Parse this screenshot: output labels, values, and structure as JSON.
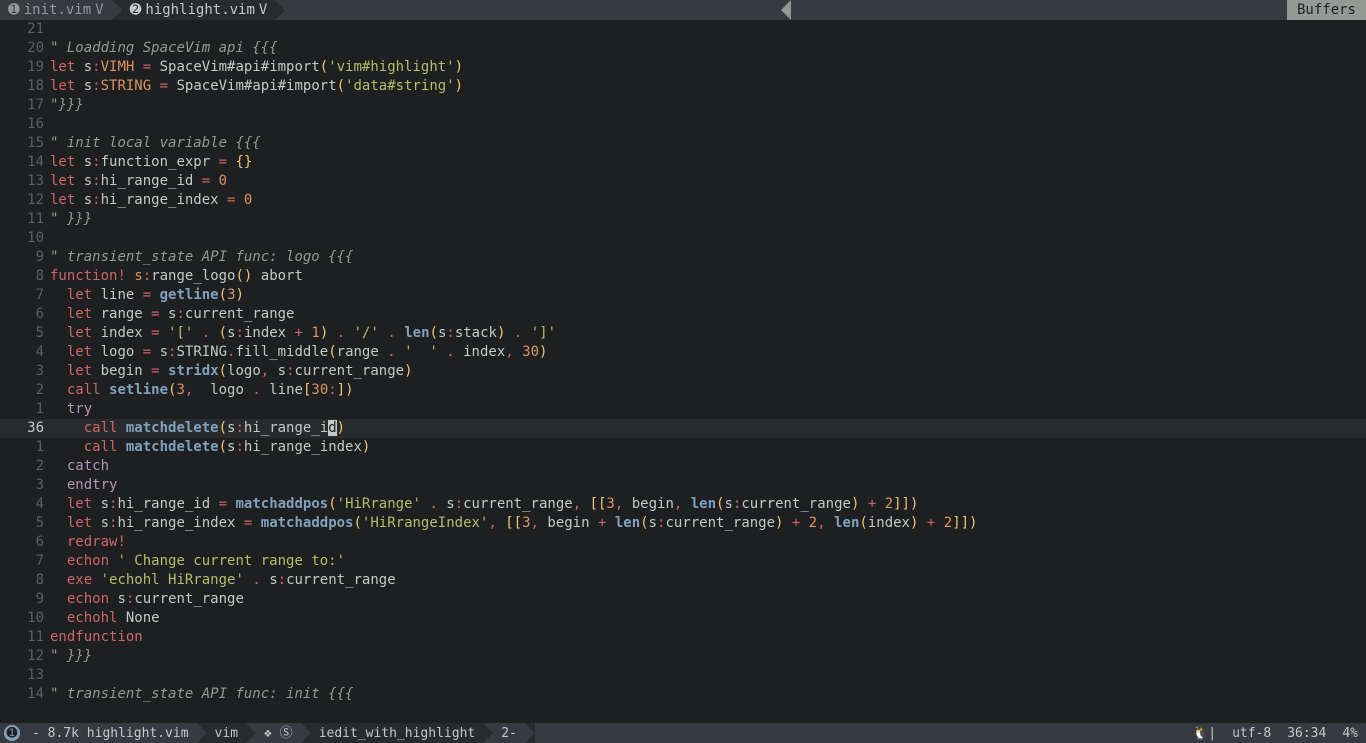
{
  "tabline": {
    "tabs": [
      {
        "num": "➊",
        "name": "init.vim",
        "active": false
      },
      {
        "num": "➋",
        "name": "highlight.vim",
        "active": true
      }
    ],
    "buffers_label": "Buffers"
  },
  "statusline": {
    "window_num": "➊",
    "file_info": "- 8.7k highlight.vim",
    "filetype": "vim",
    "spell": "❖ Ⓢ",
    "branch": "  iedit_with_highlight",
    "iedit": "2-",
    "os_icon": "🐧",
    "encoding": "utf-8",
    "position": "36:34",
    "percent": "4%"
  },
  "cursor_line_abs": 36,
  "lines": [
    {
      "rel": "21",
      "code": []
    },
    {
      "rel": "20",
      "code": [
        [
          "comment",
          "\""
        ],
        [
          "comment",
          " Loadding SpaceVim api {{{"
        ]
      ]
    },
    {
      "rel": "19",
      "code": [
        [
          "kw",
          "let"
        ],
        [
          "ident",
          " s"
        ],
        [
          "sp",
          ":"
        ],
        [
          "scope",
          "VIMH"
        ],
        [
          "ident",
          " "
        ],
        [
          "sp",
          "="
        ],
        [
          "ident",
          " SpaceVim#api#import"
        ],
        [
          "paren",
          "("
        ],
        [
          "str",
          "'vim#highlight'"
        ],
        [
          "paren",
          ")"
        ]
      ]
    },
    {
      "rel": "18",
      "code": [
        [
          "kw",
          "let"
        ],
        [
          "ident",
          " s"
        ],
        [
          "sp",
          ":"
        ],
        [
          "scope",
          "STRING"
        ],
        [
          "ident",
          " "
        ],
        [
          "sp",
          "="
        ],
        [
          "ident",
          " SpaceVim#api#import"
        ],
        [
          "paren",
          "("
        ],
        [
          "str",
          "'data#string'"
        ],
        [
          "paren",
          ")"
        ]
      ]
    },
    {
      "rel": "17",
      "code": [
        [
          "comment",
          "\""
        ],
        [
          "comment",
          "}}}"
        ]
      ]
    },
    {
      "rel": "16",
      "code": []
    },
    {
      "rel": "15",
      "code": [
        [
          "comment",
          "\""
        ],
        [
          "comment",
          " init local variable {{{"
        ]
      ]
    },
    {
      "rel": "14",
      "code": [
        [
          "kw",
          "let"
        ],
        [
          "ident",
          " s"
        ],
        [
          "sp",
          ":"
        ],
        [
          "ident",
          "function_expr "
        ],
        [
          "sp",
          "="
        ],
        [
          "ident",
          " "
        ],
        [
          "paren",
          "{}"
        ]
      ]
    },
    {
      "rel": "13",
      "code": [
        [
          "kw",
          "let"
        ],
        [
          "ident",
          " s"
        ],
        [
          "sp",
          ":"
        ],
        [
          "ident",
          "hi_range_id "
        ],
        [
          "sp",
          "="
        ],
        [
          "ident",
          " "
        ],
        [
          "num",
          "0"
        ]
      ]
    },
    {
      "rel": "12",
      "code": [
        [
          "kw",
          "let"
        ],
        [
          "ident",
          " s"
        ],
        [
          "sp",
          ":"
        ],
        [
          "ident",
          "hi_range_index "
        ],
        [
          "sp",
          "="
        ],
        [
          "ident",
          " "
        ],
        [
          "num",
          "0"
        ]
      ]
    },
    {
      "rel": "11",
      "code": [
        [
          "comment",
          "\""
        ],
        [
          "comment",
          " }}}"
        ]
      ]
    },
    {
      "rel": "10",
      "code": []
    },
    {
      "rel": "9",
      "code": [
        [
          "comment",
          "\""
        ],
        [
          "comment",
          " transient_state API func: logo {{{"
        ]
      ]
    },
    {
      "rel": "8",
      "code": [
        [
          "kw",
          "function"
        ],
        [
          "sp",
          "!"
        ],
        [
          "ident",
          " "
        ],
        [
          "scope",
          "s"
        ],
        [
          "sp",
          ":"
        ],
        [
          "ident",
          "range_logo"
        ],
        [
          "paren",
          "()"
        ],
        [
          "ident",
          " abort"
        ]
      ]
    },
    {
      "rel": "7",
      "code": [
        [
          "ident",
          "  "
        ],
        [
          "kw",
          "let"
        ],
        [
          "ident",
          " line "
        ],
        [
          "sp",
          "="
        ],
        [
          "ident",
          " "
        ],
        [
          "func",
          "getline"
        ],
        [
          "paren",
          "("
        ],
        [
          "num",
          "3"
        ],
        [
          "paren",
          ")"
        ]
      ]
    },
    {
      "rel": "6",
      "code": [
        [
          "ident",
          "  "
        ],
        [
          "kw",
          "let"
        ],
        [
          "ident",
          " range "
        ],
        [
          "sp",
          "="
        ],
        [
          "ident",
          " s"
        ],
        [
          "sp",
          ":"
        ],
        [
          "ident",
          "current_range"
        ]
      ]
    },
    {
      "rel": "5",
      "code": [
        [
          "ident",
          "  "
        ],
        [
          "kw",
          "let"
        ],
        [
          "ident",
          " index "
        ],
        [
          "sp",
          "="
        ],
        [
          "ident",
          " "
        ],
        [
          "str",
          "'['"
        ],
        [
          "ident",
          " "
        ],
        [
          "sp",
          "."
        ],
        [
          "ident",
          " "
        ],
        [
          "paren",
          "("
        ],
        [
          "ident",
          "s"
        ],
        [
          "sp",
          ":"
        ],
        [
          "ident",
          "index "
        ],
        [
          "sp",
          "+"
        ],
        [
          "ident",
          " "
        ],
        [
          "num",
          "1"
        ],
        [
          "paren",
          ")"
        ],
        [
          "ident",
          " "
        ],
        [
          "sp",
          "."
        ],
        [
          "ident",
          " "
        ],
        [
          "str",
          "'/'"
        ],
        [
          "ident",
          " "
        ],
        [
          "sp",
          "."
        ],
        [
          "ident",
          " "
        ],
        [
          "func",
          "len"
        ],
        [
          "paren",
          "("
        ],
        [
          "ident",
          "s"
        ],
        [
          "sp",
          ":"
        ],
        [
          "ident",
          "stack"
        ],
        [
          "paren",
          ")"
        ],
        [
          "ident",
          " "
        ],
        [
          "sp",
          "."
        ],
        [
          "ident",
          " "
        ],
        [
          "str",
          "']'"
        ]
      ]
    },
    {
      "rel": "4",
      "code": [
        [
          "ident",
          "  "
        ],
        [
          "kw",
          "let"
        ],
        [
          "ident",
          " logo "
        ],
        [
          "sp",
          "="
        ],
        [
          "ident",
          " s"
        ],
        [
          "sp",
          ":"
        ],
        [
          "ident",
          "STRING"
        ],
        [
          "sp",
          "."
        ],
        [
          "ident",
          "fill_middle"
        ],
        [
          "paren",
          "("
        ],
        [
          "ident",
          "range "
        ],
        [
          "sp",
          "."
        ],
        [
          "ident",
          " "
        ],
        [
          "str",
          "'  '"
        ],
        [
          "ident",
          " "
        ],
        [
          "sp",
          "."
        ],
        [
          "ident",
          " index"
        ],
        [
          "sp",
          ","
        ],
        [
          "ident",
          " "
        ],
        [
          "num",
          "30"
        ],
        [
          "paren",
          ")"
        ]
      ]
    },
    {
      "rel": "3",
      "code": [
        [
          "ident",
          "  "
        ],
        [
          "kw",
          "let"
        ],
        [
          "ident",
          " begin "
        ],
        [
          "sp",
          "="
        ],
        [
          "ident",
          " "
        ],
        [
          "func",
          "stridx"
        ],
        [
          "paren",
          "("
        ],
        [
          "ident",
          "logo"
        ],
        [
          "sp",
          ","
        ],
        [
          "ident",
          " s"
        ],
        [
          "sp",
          ":"
        ],
        [
          "ident",
          "current_range"
        ],
        [
          "paren",
          ")"
        ]
      ]
    },
    {
      "rel": "2",
      "code": [
        [
          "ident",
          "  "
        ],
        [
          "kw",
          "call"
        ],
        [
          "ident",
          " "
        ],
        [
          "func",
          "setline"
        ],
        [
          "paren",
          "("
        ],
        [
          "num",
          "3"
        ],
        [
          "sp",
          ","
        ],
        [
          "ident",
          "  logo "
        ],
        [
          "sp",
          "."
        ],
        [
          "ident",
          " line"
        ],
        [
          "paren",
          "["
        ],
        [
          "num",
          "30"
        ],
        [
          "sp",
          ":"
        ],
        [
          "paren",
          "]"
        ],
        [
          "paren",
          ")"
        ]
      ]
    },
    {
      "rel": "1",
      "code": [
        [
          "ident",
          "  "
        ],
        [
          "kw2",
          "try"
        ]
      ]
    },
    {
      "rel": "36",
      "current": true,
      "code": [
        [
          "ident",
          "    "
        ],
        [
          "kw",
          "call"
        ],
        [
          "ident",
          " "
        ],
        [
          "func",
          "matchdelete"
        ],
        [
          "paren",
          "("
        ],
        [
          "ident",
          "s"
        ],
        [
          "sp",
          ":"
        ],
        [
          "ident",
          "hi_range_i"
        ],
        [
          "cursor",
          "d"
        ],
        [
          "paren",
          ")"
        ]
      ]
    },
    {
      "rel": "1",
      "code": [
        [
          "ident",
          "    "
        ],
        [
          "kw",
          "call"
        ],
        [
          "ident",
          " "
        ],
        [
          "func",
          "matchdelete"
        ],
        [
          "paren",
          "("
        ],
        [
          "ident",
          "s"
        ],
        [
          "sp",
          ":"
        ],
        [
          "ident",
          "hi_range_index"
        ],
        [
          "paren",
          ")"
        ]
      ]
    },
    {
      "rel": "2",
      "code": [
        [
          "ident",
          "  "
        ],
        [
          "kw2",
          "catch"
        ]
      ]
    },
    {
      "rel": "3",
      "code": [
        [
          "ident",
          "  "
        ],
        [
          "kw2",
          "endtry"
        ]
      ]
    },
    {
      "rel": "4",
      "code": [
        [
          "ident",
          "  "
        ],
        [
          "kw",
          "let"
        ],
        [
          "ident",
          " s"
        ],
        [
          "sp",
          ":"
        ],
        [
          "ident",
          "hi_range_id "
        ],
        [
          "sp",
          "="
        ],
        [
          "ident",
          " "
        ],
        [
          "func",
          "matchaddpos"
        ],
        [
          "paren",
          "("
        ],
        [
          "str",
          "'HiRrange'"
        ],
        [
          "ident",
          " "
        ],
        [
          "sp",
          "."
        ],
        [
          "ident",
          " s"
        ],
        [
          "sp",
          ":"
        ],
        [
          "ident",
          "current_range"
        ],
        [
          "sp",
          ","
        ],
        [
          "ident",
          " "
        ],
        [
          "paren",
          "[["
        ],
        [
          "num",
          "3"
        ],
        [
          "sp",
          ","
        ],
        [
          "ident",
          " begin"
        ],
        [
          "sp",
          ","
        ],
        [
          "ident",
          " "
        ],
        [
          "func",
          "len"
        ],
        [
          "paren",
          "("
        ],
        [
          "ident",
          "s"
        ],
        [
          "sp",
          ":"
        ],
        [
          "ident",
          "current_range"
        ],
        [
          "paren",
          ")"
        ],
        [
          "ident",
          " "
        ],
        [
          "sp",
          "+"
        ],
        [
          "ident",
          " "
        ],
        [
          "num",
          "2"
        ],
        [
          "paren",
          "]]"
        ],
        [
          "paren",
          ")"
        ]
      ]
    },
    {
      "rel": "5",
      "code": [
        [
          "ident",
          "  "
        ],
        [
          "kw",
          "let"
        ],
        [
          "ident",
          " s"
        ],
        [
          "sp",
          ":"
        ],
        [
          "ident",
          "hi_range_index "
        ],
        [
          "sp",
          "="
        ],
        [
          "ident",
          " "
        ],
        [
          "func",
          "matchaddpos"
        ],
        [
          "paren",
          "("
        ],
        [
          "str",
          "'HiRrangeIndex'"
        ],
        [
          "sp",
          ","
        ],
        [
          "ident",
          " "
        ],
        [
          "paren",
          "[["
        ],
        [
          "num",
          "3"
        ],
        [
          "sp",
          ","
        ],
        [
          "ident",
          " begin "
        ],
        [
          "sp",
          "+"
        ],
        [
          "ident",
          " "
        ],
        [
          "func",
          "len"
        ],
        [
          "paren",
          "("
        ],
        [
          "ident",
          "s"
        ],
        [
          "sp",
          ":"
        ],
        [
          "ident",
          "current_range"
        ],
        [
          "paren",
          ")"
        ],
        [
          "ident",
          " "
        ],
        [
          "sp",
          "+"
        ],
        [
          "ident",
          " "
        ],
        [
          "num",
          "2"
        ],
        [
          "sp",
          ","
        ],
        [
          "ident",
          " "
        ],
        [
          "func",
          "len"
        ],
        [
          "paren",
          "("
        ],
        [
          "ident",
          "index"
        ],
        [
          "paren",
          ")"
        ],
        [
          "ident",
          " "
        ],
        [
          "sp",
          "+"
        ],
        [
          "ident",
          " "
        ],
        [
          "num",
          "2"
        ],
        [
          "paren",
          "]]"
        ],
        [
          "paren",
          ")"
        ]
      ]
    },
    {
      "rel": "6",
      "code": [
        [
          "ident",
          "  "
        ],
        [
          "kw",
          "redraw"
        ],
        [
          "sp",
          "!"
        ]
      ]
    },
    {
      "rel": "7",
      "code": [
        [
          "ident",
          "  "
        ],
        [
          "kw",
          "echon"
        ],
        [
          "ident",
          " "
        ],
        [
          "str",
          "' Change current range to:'"
        ]
      ]
    },
    {
      "rel": "8",
      "code": [
        [
          "ident",
          "  "
        ],
        [
          "kw",
          "exe"
        ],
        [
          "ident",
          " "
        ],
        [
          "str",
          "'echohl HiRrange'"
        ],
        [
          "ident",
          " "
        ],
        [
          "sp",
          "."
        ],
        [
          "ident",
          " s"
        ],
        [
          "sp",
          ":"
        ],
        [
          "ident",
          "current_range"
        ]
      ]
    },
    {
      "rel": "9",
      "code": [
        [
          "ident",
          "  "
        ],
        [
          "kw",
          "echon"
        ],
        [
          "ident",
          " s"
        ],
        [
          "sp",
          ":"
        ],
        [
          "ident",
          "current_range"
        ]
      ]
    },
    {
      "rel": "10",
      "code": [
        [
          "ident",
          "  "
        ],
        [
          "kw",
          "echohl"
        ],
        [
          "ident",
          " None"
        ]
      ]
    },
    {
      "rel": "11",
      "code": [
        [
          "kw",
          "endfunction"
        ]
      ]
    },
    {
      "rel": "12",
      "code": [
        [
          "comment",
          "\""
        ],
        [
          "comment",
          " }}}"
        ]
      ]
    },
    {
      "rel": "13",
      "code": []
    },
    {
      "rel": "14",
      "code": [
        [
          "comment",
          "\""
        ],
        [
          "comment",
          " transient_state API func: init {{{"
        ]
      ]
    }
  ]
}
